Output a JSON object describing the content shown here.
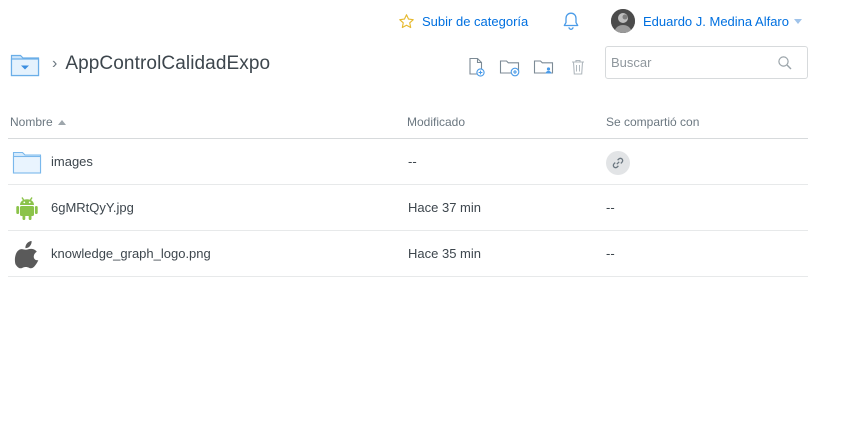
{
  "header": {
    "upgrade_label": "Subir de categoría",
    "account_name": "Eduardo J. Medina Alfaro"
  },
  "breadcrumb": {
    "title": "AppControlCalidadExpo"
  },
  "search": {
    "placeholder": "Buscar"
  },
  "table": {
    "columns": {
      "name": "Nombre",
      "modified": "Modificado",
      "shared": "Se compartió con"
    },
    "rows": [
      {
        "name": "images",
        "modified": "--",
        "shared": "",
        "icon": "folder-icon"
      },
      {
        "name": "6gMRtQyY.jpg",
        "modified": "Hace 37 min",
        "shared": "--",
        "icon": "android-icon"
      },
      {
        "name": "knowledge_graph_logo.png",
        "modified": "Hace 35 min",
        "shared": "--",
        "icon": "apple-icon"
      }
    ]
  },
  "colors": {
    "accent": "#0070e0",
    "star": "#e6b92e",
    "folder": "#a8d1f4",
    "android": "#8bc34a",
    "apple": "#5a5a5a"
  }
}
